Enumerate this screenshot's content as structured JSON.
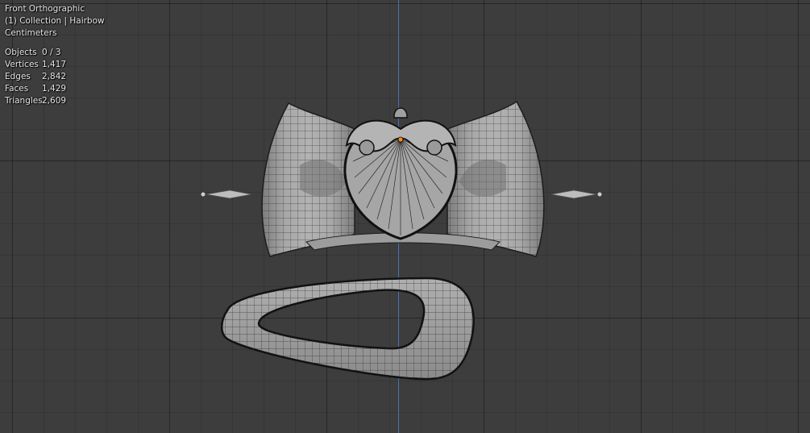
{
  "viewport": {
    "view_name": "Front Orthographic",
    "collection": "(1) Collection | Hairbow",
    "units": "Centimeters"
  },
  "stats": [
    {
      "label": "Objects",
      "value": "0 / 3"
    },
    {
      "label": "Vertices",
      "value": "1,417"
    },
    {
      "label": "Edges",
      "value": "2,842"
    },
    {
      "label": "Faces",
      "value": "1,429"
    },
    {
      "label": "Triangles",
      "value": "2,609"
    }
  ],
  "colors": {
    "background": "#3d3d3d",
    "mesh_fill": "#9a9a9a",
    "wire": "#1c1c1c",
    "z_axis": "#4a6fb5",
    "origin": "#ff8c1a"
  }
}
